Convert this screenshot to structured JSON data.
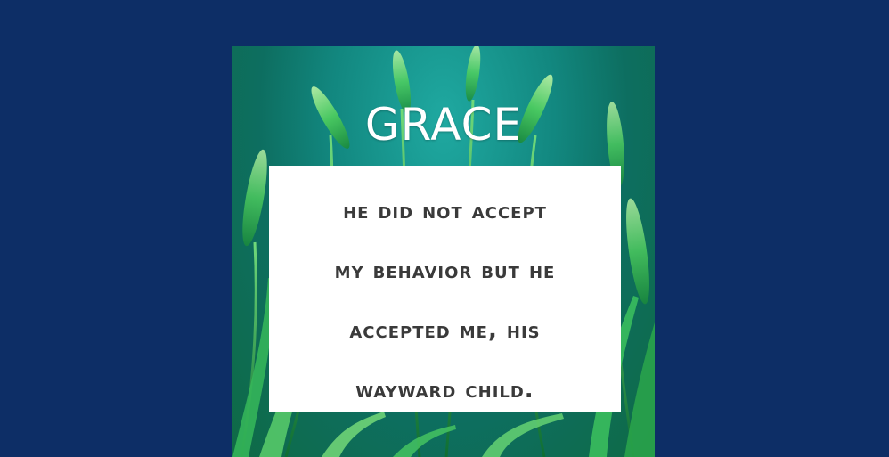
{
  "title": "GRACE",
  "quote_lines": [
    "He did not accept",
    "my behavior but he",
    "accepted me, his",
    "wayward child."
  ],
  "colors": {
    "background": "#0d2e66",
    "quote_box": "#ffffff",
    "quote_text": "#3a3a3a",
    "title_text": "#ffffff",
    "grass_light": "#7be07a",
    "grass_dark": "#1f8a3c"
  }
}
